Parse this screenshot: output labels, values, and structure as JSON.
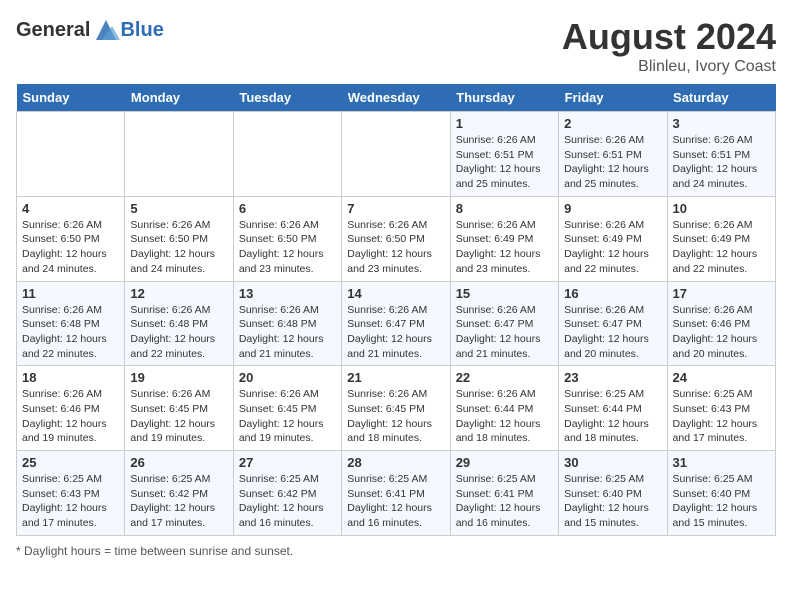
{
  "header": {
    "logo_general": "General",
    "logo_blue": "Blue",
    "month_year": "August 2024",
    "location": "Blinleu, Ivory Coast"
  },
  "footer": {
    "note": "Daylight hours"
  },
  "days_of_week": [
    "Sunday",
    "Monday",
    "Tuesday",
    "Wednesday",
    "Thursday",
    "Friday",
    "Saturday"
  ],
  "weeks": [
    {
      "days": [
        {
          "num": "",
          "info": ""
        },
        {
          "num": "",
          "info": ""
        },
        {
          "num": "",
          "info": ""
        },
        {
          "num": "",
          "info": ""
        },
        {
          "num": "1",
          "info": "Sunrise: 6:26 AM\nSunset: 6:51 PM\nDaylight: 12 hours\nand 25 minutes."
        },
        {
          "num": "2",
          "info": "Sunrise: 6:26 AM\nSunset: 6:51 PM\nDaylight: 12 hours\nand 25 minutes."
        },
        {
          "num": "3",
          "info": "Sunrise: 6:26 AM\nSunset: 6:51 PM\nDaylight: 12 hours\nand 24 minutes."
        }
      ]
    },
    {
      "days": [
        {
          "num": "4",
          "info": "Sunrise: 6:26 AM\nSunset: 6:50 PM\nDaylight: 12 hours\nand 24 minutes."
        },
        {
          "num": "5",
          "info": "Sunrise: 6:26 AM\nSunset: 6:50 PM\nDaylight: 12 hours\nand 24 minutes."
        },
        {
          "num": "6",
          "info": "Sunrise: 6:26 AM\nSunset: 6:50 PM\nDaylight: 12 hours\nand 23 minutes."
        },
        {
          "num": "7",
          "info": "Sunrise: 6:26 AM\nSunset: 6:50 PM\nDaylight: 12 hours\nand 23 minutes."
        },
        {
          "num": "8",
          "info": "Sunrise: 6:26 AM\nSunset: 6:49 PM\nDaylight: 12 hours\nand 23 minutes."
        },
        {
          "num": "9",
          "info": "Sunrise: 6:26 AM\nSunset: 6:49 PM\nDaylight: 12 hours\nand 22 minutes."
        },
        {
          "num": "10",
          "info": "Sunrise: 6:26 AM\nSunset: 6:49 PM\nDaylight: 12 hours\nand 22 minutes."
        }
      ]
    },
    {
      "days": [
        {
          "num": "11",
          "info": "Sunrise: 6:26 AM\nSunset: 6:48 PM\nDaylight: 12 hours\nand 22 minutes."
        },
        {
          "num": "12",
          "info": "Sunrise: 6:26 AM\nSunset: 6:48 PM\nDaylight: 12 hours\nand 22 minutes."
        },
        {
          "num": "13",
          "info": "Sunrise: 6:26 AM\nSunset: 6:48 PM\nDaylight: 12 hours\nand 21 minutes."
        },
        {
          "num": "14",
          "info": "Sunrise: 6:26 AM\nSunset: 6:47 PM\nDaylight: 12 hours\nand 21 minutes."
        },
        {
          "num": "15",
          "info": "Sunrise: 6:26 AM\nSunset: 6:47 PM\nDaylight: 12 hours\nand 21 minutes."
        },
        {
          "num": "16",
          "info": "Sunrise: 6:26 AM\nSunset: 6:47 PM\nDaylight: 12 hours\nand 20 minutes."
        },
        {
          "num": "17",
          "info": "Sunrise: 6:26 AM\nSunset: 6:46 PM\nDaylight: 12 hours\nand 20 minutes."
        }
      ]
    },
    {
      "days": [
        {
          "num": "18",
          "info": "Sunrise: 6:26 AM\nSunset: 6:46 PM\nDaylight: 12 hours\nand 19 minutes."
        },
        {
          "num": "19",
          "info": "Sunrise: 6:26 AM\nSunset: 6:45 PM\nDaylight: 12 hours\nand 19 minutes."
        },
        {
          "num": "20",
          "info": "Sunrise: 6:26 AM\nSunset: 6:45 PM\nDaylight: 12 hours\nand 19 minutes."
        },
        {
          "num": "21",
          "info": "Sunrise: 6:26 AM\nSunset: 6:45 PM\nDaylight: 12 hours\nand 18 minutes."
        },
        {
          "num": "22",
          "info": "Sunrise: 6:26 AM\nSunset: 6:44 PM\nDaylight: 12 hours\nand 18 minutes."
        },
        {
          "num": "23",
          "info": "Sunrise: 6:25 AM\nSunset: 6:44 PM\nDaylight: 12 hours\nand 18 minutes."
        },
        {
          "num": "24",
          "info": "Sunrise: 6:25 AM\nSunset: 6:43 PM\nDaylight: 12 hours\nand 17 minutes."
        }
      ]
    },
    {
      "days": [
        {
          "num": "25",
          "info": "Sunrise: 6:25 AM\nSunset: 6:43 PM\nDaylight: 12 hours\nand 17 minutes."
        },
        {
          "num": "26",
          "info": "Sunrise: 6:25 AM\nSunset: 6:42 PM\nDaylight: 12 hours\nand 17 minutes."
        },
        {
          "num": "27",
          "info": "Sunrise: 6:25 AM\nSunset: 6:42 PM\nDaylight: 12 hours\nand 16 minutes."
        },
        {
          "num": "28",
          "info": "Sunrise: 6:25 AM\nSunset: 6:41 PM\nDaylight: 12 hours\nand 16 minutes."
        },
        {
          "num": "29",
          "info": "Sunrise: 6:25 AM\nSunset: 6:41 PM\nDaylight: 12 hours\nand 16 minutes."
        },
        {
          "num": "30",
          "info": "Sunrise: 6:25 AM\nSunset: 6:40 PM\nDaylight: 12 hours\nand 15 minutes."
        },
        {
          "num": "31",
          "info": "Sunrise: 6:25 AM\nSunset: 6:40 PM\nDaylight: 12 hours\nand 15 minutes."
        }
      ]
    }
  ]
}
